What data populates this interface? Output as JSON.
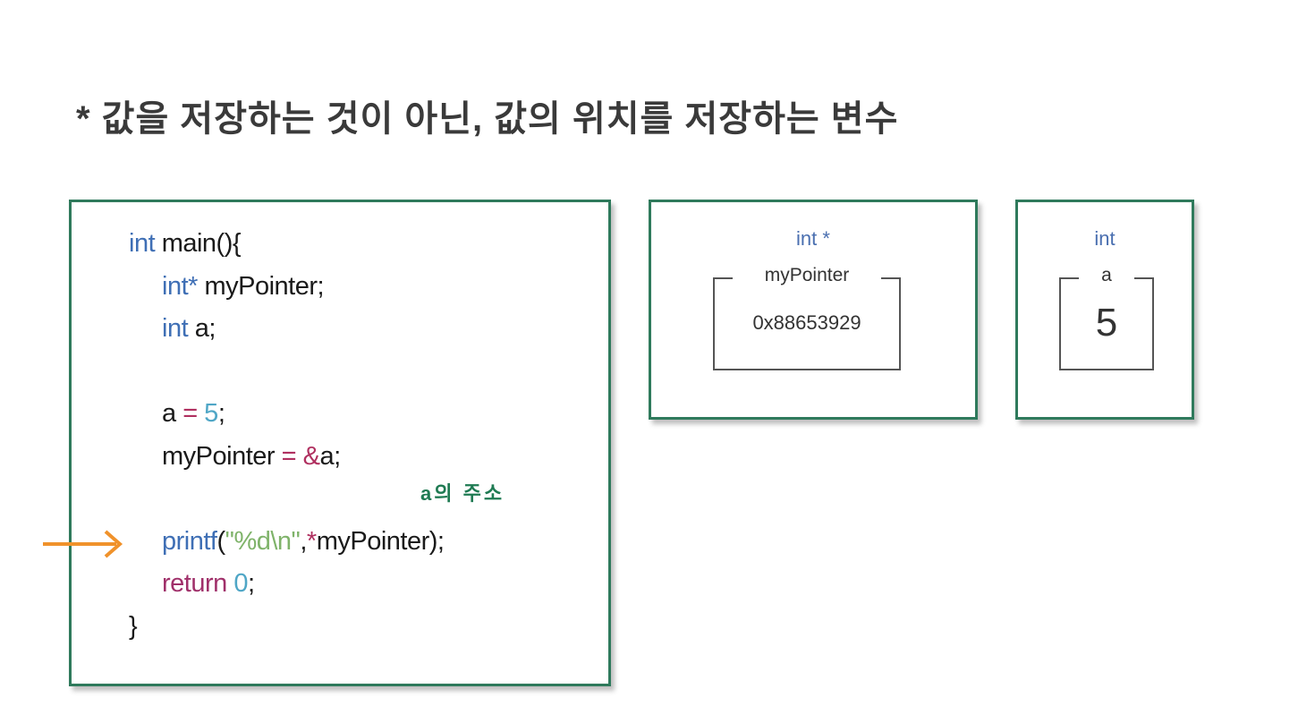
{
  "title": "* 값을 저장하는 것이 아닌, 값의 위치를 저장하는 변수",
  "code": {
    "lines": [
      [
        {
          "t": "int",
          "c": "kw"
        },
        {
          "t": " main(){",
          "c": "plain"
        }
      ],
      [
        {
          "t": "int*",
          "c": "kw"
        },
        {
          "t": " myPointer;",
          "c": "plain"
        }
      ],
      [
        {
          "t": "int",
          "c": "kw"
        },
        {
          "t": " a;",
          "c": "plain"
        }
      ],
      [
        {
          "t": "a ",
          "c": "plain"
        },
        {
          "t": "=",
          "c": "op"
        },
        {
          "t": " 5",
          "c": "num"
        },
        {
          "t": ";",
          "c": "plain"
        }
      ],
      [
        {
          "t": "myPointer ",
          "c": "plain"
        },
        {
          "t": "=",
          "c": "op"
        },
        {
          "t": " &",
          "c": "op"
        },
        {
          "t": "a;",
          "c": "plain"
        }
      ],
      [
        {
          "t": "printf",
          "c": "kw"
        },
        {
          "t": "(",
          "c": "plain"
        },
        {
          "t": "\"%d\\n\"",
          "c": "str"
        },
        {
          "t": ",",
          "c": "plain"
        },
        {
          "t": "*",
          "c": "op"
        },
        {
          "t": "myPointer);",
          "c": "plain"
        }
      ],
      [
        {
          "t": "return",
          "c": "ret"
        },
        {
          "t": " 0",
          "c": "num"
        },
        {
          "t": ";",
          "c": "plain"
        }
      ],
      [
        {
          "t": "}",
          "c": "plain"
        }
      ]
    ],
    "annotation": "a의 주소",
    "current_line_marker": "arrow-right-icon",
    "marker_color": "#f0922b"
  },
  "memory": [
    {
      "type": "int *",
      "name": "myPointer",
      "value": "0x88653929"
    },
    {
      "type": "int",
      "name": "a",
      "value": "5"
    }
  ],
  "colors": {
    "box_border": "#2f7a5c",
    "keyword": "#3f6fb5",
    "annotation": "#1e7a52"
  }
}
